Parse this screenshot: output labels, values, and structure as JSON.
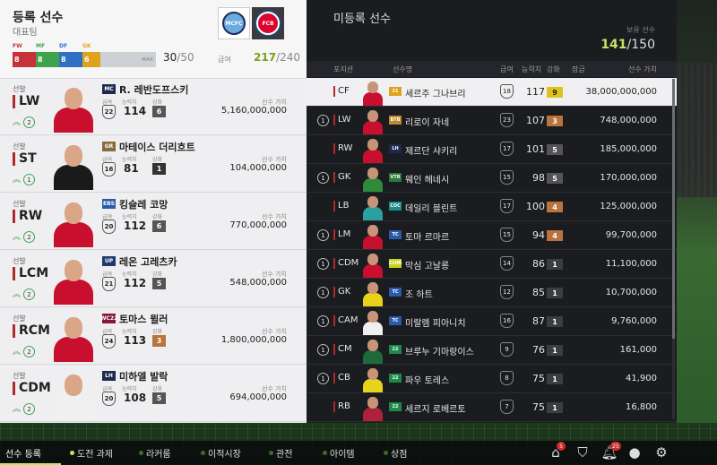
{
  "left_header": {
    "title": "등록 선수",
    "subtitle": "대표팀",
    "pos_labels": [
      "FW",
      "MF",
      "DF",
      "GK"
    ],
    "pos_counts": [
      "8",
      "8",
      "8",
      "6"
    ],
    "pos_colors": [
      "#c8303a",
      "#3fa34d",
      "#2f6fc4",
      "#e0a21c"
    ],
    "pos_label_colors": [
      "#c8303a",
      "#3fa34d",
      "#2f6fc4",
      "#e0a21c"
    ],
    "max_label": "MAX",
    "count": "30",
    "count_total": "/50",
    "salary_label": "급여",
    "salary": "217",
    "salary_total": "/240"
  },
  "labels": {
    "salary": "급여",
    "ovr": "능력치",
    "grade": "강화",
    "value": "선수 가치",
    "role": "선발"
  },
  "lineup": [
    {
      "pos": "LW",
      "season": "MC",
      "season_color": "#1d2a4e",
      "name": "R. 레반도프스키",
      "level": "2",
      "salary": "22",
      "ovr": "114",
      "grade": "6",
      "grade_color": "#555",
      "value": "5,160,000,000",
      "kit": "#c8102e"
    },
    {
      "pos": "ST",
      "season": "GR",
      "season_color": "#8a6b3a",
      "name": "마테이스 더리흐트",
      "level": "1",
      "salary": "16",
      "ovr": "81",
      "grade": "1",
      "grade_color": "#333",
      "value": "104,000,000",
      "kit": "#1a1a1a"
    },
    {
      "pos": "RW",
      "season": "EBS",
      "season_color": "#2a5aa8",
      "name": "킹슬레 코망",
      "level": "2",
      "salary": "20",
      "ovr": "112",
      "grade": "6",
      "grade_color": "#555",
      "value": "770,000,000",
      "kit": "#c8102e"
    },
    {
      "pos": "LCM",
      "season": "UP",
      "season_color": "#1d3a6e",
      "name": "레온 고레츠카",
      "level": "2",
      "salary": "21",
      "ovr": "112",
      "grade": "5",
      "grade_color": "#555",
      "value": "548,000,000",
      "kit": "#c8102e"
    },
    {
      "pos": "RCM",
      "season": "WC22",
      "season_color": "#8a1538",
      "name": "토마스 뮐러",
      "level": "2",
      "salary": "24",
      "ovr": "113",
      "grade": "3",
      "grade_color": "#b8733e",
      "value": "1,800,000,000",
      "kit": "#c8102e"
    },
    {
      "pos": "CDM",
      "season": "LH",
      "season_color": "#1d2a4e",
      "name": "미하엘 발락",
      "level": "2",
      "salary": "20",
      "ovr": "108",
      "grade": "5",
      "grade_color": "#555",
      "value": "694,000,000",
      "kit": "#f0f0f0"
    }
  ],
  "right_header": {
    "title": "미등록 선수",
    "owned_label": "보유 선수",
    "owned": "141",
    "owned_total": "/150"
  },
  "columns": {
    "pos": "포지션",
    "name": "선수명",
    "salary": "급여",
    "ovr": "능력치",
    "grade": "강화",
    "lock": "잠금",
    "value": "선수 가치"
  },
  "unregistered": [
    {
      "level": "",
      "pos": "CF",
      "season": "21",
      "season_color": "#e0a21c",
      "name": "세르주 그나브리",
      "salary": "18",
      "ovr": "117",
      "grade": "9",
      "grade_color": "#e0c21c",
      "value": "38,000,000,000",
      "kit": "#c8102e",
      "selected": true
    },
    {
      "level": "1",
      "pos": "LW",
      "season": "BTB",
      "season_color": "#c08a2a",
      "name": "리로이 자네",
      "salary": "23",
      "ovr": "107",
      "grade": "3",
      "grade_color": "#b8733e",
      "value": "748,000,000",
      "kit": "#c8102e",
      "selected": false
    },
    {
      "level": "",
      "pos": "RW",
      "season": "LH",
      "season_color": "#1d2a4e",
      "name": "제르단 샤키리",
      "salary": "17",
      "ovr": "101",
      "grade": "5",
      "grade_color": "#555",
      "value": "185,000,000",
      "kit": "#c8102e",
      "selected": false
    },
    {
      "level": "1",
      "pos": "GK",
      "season": "VTR",
      "season_color": "#2a7a3a",
      "name": "웨인 헤네시",
      "salary": "15",
      "ovr": "98",
      "grade": "5",
      "grade_color": "#555",
      "value": "170,000,000",
      "kit": "#2e8b3a",
      "selected": false
    },
    {
      "level": "",
      "pos": "LB",
      "season": "COC",
      "season_color": "#1d8a8a",
      "name": "데일리 블린트",
      "salary": "17",
      "ovr": "100",
      "grade": "4",
      "grade_color": "#b8733e",
      "value": "125,000,000",
      "kit": "#2aa0a0",
      "selected": false
    },
    {
      "level": "1",
      "pos": "LM",
      "season": "TC",
      "season_color": "#2a5aa8",
      "name": "토마 르마르",
      "salary": "15",
      "ovr": "94",
      "grade": "4",
      "grade_color": "#b8733e",
      "value": "99,700,000",
      "kit": "#c8102e",
      "selected": false
    },
    {
      "level": "1",
      "pos": "CDM",
      "season": "22HR",
      "season_color": "#c9d21a",
      "name": "막심 고날롱",
      "salary": "14",
      "ovr": "86",
      "grade": "1",
      "grade_color": "#3a3d42",
      "value": "11,100,000",
      "kit": "#c8102e",
      "selected": false
    },
    {
      "level": "1",
      "pos": "GK",
      "season": "TC",
      "season_color": "#2a5aa8",
      "name": "조 하트",
      "salary": "12",
      "ovr": "85",
      "grade": "1",
      "grade_color": "#3a3d42",
      "value": "10,700,000",
      "kit": "#e8d21a",
      "selected": false
    },
    {
      "level": "1",
      "pos": "CAM",
      "season": "TC",
      "season_color": "#2a5aa8",
      "name": "미랄렘 피아니치",
      "salary": "16",
      "ovr": "87",
      "grade": "1",
      "grade_color": "#3a3d42",
      "value": "9,760,000",
      "kit": "#f0f0f0",
      "selected": false
    },
    {
      "level": "1",
      "pos": "CM",
      "season": "22",
      "season_color": "#1d8a4a",
      "name": "브루누 기마랑이스",
      "salary": "9",
      "ovr": "76",
      "grade": "1",
      "grade_color": "#3a3d42",
      "value": "161,000",
      "kit": "#1d6a3a",
      "selected": false
    },
    {
      "level": "1",
      "pos": "CB",
      "season": "22",
      "season_color": "#1d8a4a",
      "name": "파우 토레스",
      "salary": "8",
      "ovr": "75",
      "grade": "1",
      "grade_color": "#3a3d42",
      "value": "41,900",
      "kit": "#e8d21a",
      "selected": false
    },
    {
      "level": "",
      "pos": "RB",
      "season": "22",
      "season_color": "#1d8a4a",
      "name": "세르지 로베르토",
      "salary": "7",
      "ovr": "75",
      "grade": "1",
      "grade_color": "#3a3d42",
      "value": "16,800",
      "kit": "#b0203a",
      "selected": false
    }
  ],
  "nav": {
    "items": [
      "선수 등록",
      "도전 과제",
      "라커룸",
      "이적시장",
      "관전",
      "아이템",
      "상점"
    ],
    "active": 0,
    "icons": [
      {
        "name": "home-icon",
        "badge": "5"
      },
      {
        "name": "club-shield-icon",
        "badge": ""
      },
      {
        "name": "bell-icon",
        "badge": "25"
      },
      {
        "name": "profile-icon",
        "badge": ""
      },
      {
        "name": "gear-icon",
        "badge": ""
      }
    ]
  }
}
